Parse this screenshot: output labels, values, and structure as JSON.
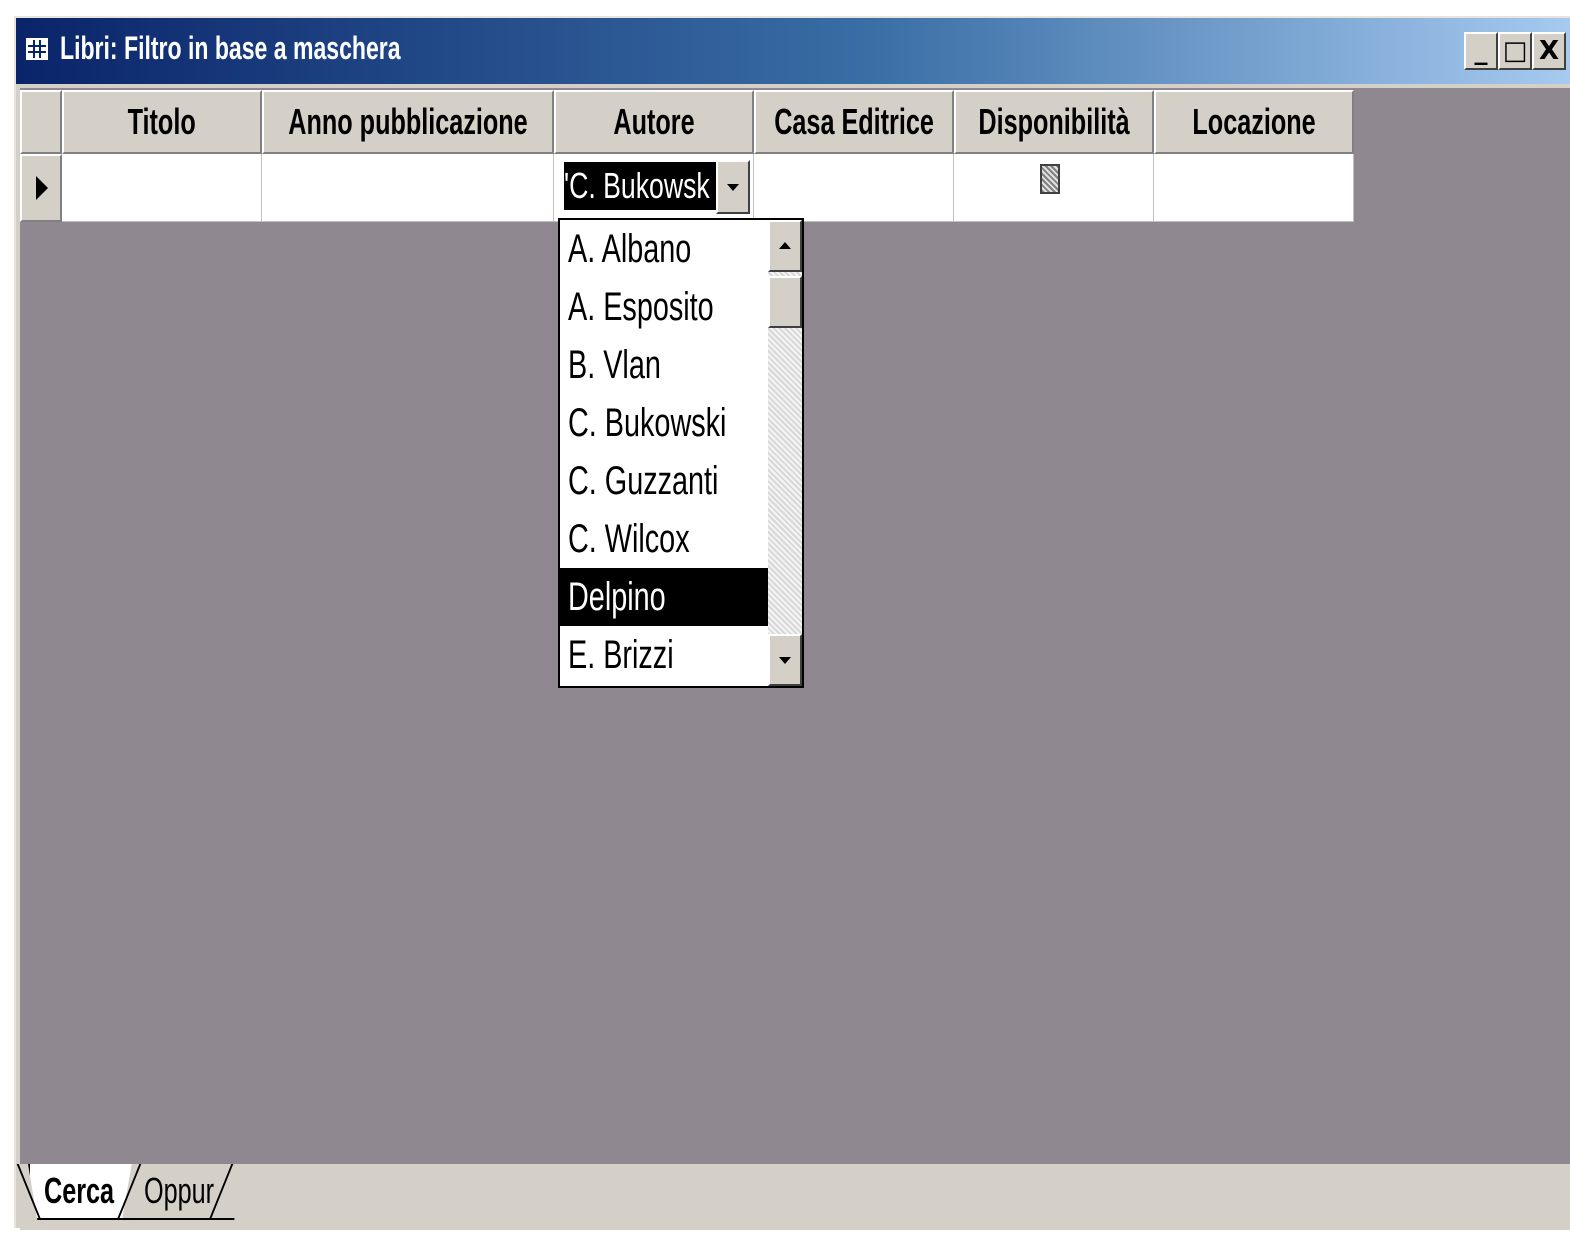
{
  "window": {
    "title": "Libri: Filtro in base a maschera",
    "icon": "datasheet-icon",
    "buttons": {
      "minimize": "_",
      "maximize": "□",
      "close": "X"
    }
  },
  "grid": {
    "columns": [
      "Titolo",
      "Anno pubblicazione",
      "Autore",
      "Casa Editrice",
      "Disponibilità",
      "Locazione"
    ],
    "current_row": {
      "autore_value": "'C. Bukowsk"
    }
  },
  "dropdown": {
    "options": [
      "A. Albano",
      "A. Esposito",
      "B. Vlan",
      "C. Bukowski",
      "C. Guzzanti",
      "C. Wilcox",
      "Delpino",
      "E. Brizzi"
    ],
    "selected": "Delpino"
  },
  "tabs": {
    "active": "Cerca",
    "inactive": "Oppur"
  },
  "colors": {
    "titlebar_start": "#0a246a",
    "titlebar_end": "#a6caf0",
    "workspace": "#8f8890",
    "selection": "#000000"
  }
}
